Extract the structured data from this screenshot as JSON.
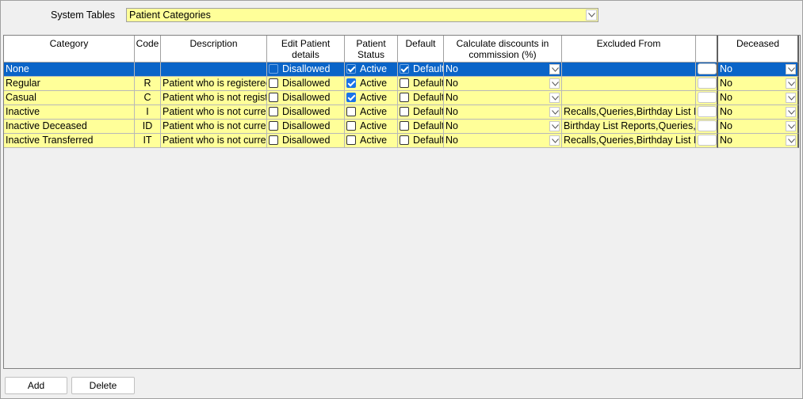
{
  "top": {
    "label": "System Tables",
    "selected": "Patient Categories"
  },
  "columns": [
    {
      "label": "Category"
    },
    {
      "label": "Code"
    },
    {
      "label": "Description"
    },
    {
      "label": "Edit Patient details"
    },
    {
      "label": "Patient Status"
    },
    {
      "label": "Default"
    },
    {
      "label": "Calculate discounts in commission (%)"
    },
    {
      "label": "Excluded From"
    },
    {
      "label": ""
    },
    {
      "label": "Deceased"
    }
  ],
  "rows": [
    {
      "category": "None",
      "code": "",
      "description": "",
      "edit_checked": false,
      "edit_label": "Disallowed",
      "status_checked": true,
      "status_label": "Active",
      "default_checked": true,
      "default_label": "Default",
      "discount": "No",
      "excluded": "",
      "deceased": "No"
    },
    {
      "category": "Regular",
      "code": "R",
      "description": "Patient who is registered",
      "edit_checked": false,
      "edit_label": "Disallowed",
      "status_checked": true,
      "status_label": "Active",
      "default_checked": false,
      "default_label": "Default",
      "discount": "No",
      "excluded": "",
      "deceased": "No"
    },
    {
      "category": "Casual",
      "code": "C",
      "description": "Patient who is not registered",
      "edit_checked": false,
      "edit_label": "Disallowed",
      "status_checked": true,
      "status_label": "Active",
      "default_checked": false,
      "default_label": "Default",
      "discount": "No",
      "excluded": "",
      "deceased": "No"
    },
    {
      "category": "Inactive",
      "code": "I",
      "description": "Patient who is not currently",
      "edit_checked": false,
      "edit_label": "Disallowed",
      "status_checked": false,
      "status_label": "Active",
      "default_checked": false,
      "default_label": "Default",
      "discount": "No",
      "excluded": "Recalls,Queries,Birthday List Reports",
      "deceased": "No"
    },
    {
      "category": "Inactive Deceased",
      "code": "ID",
      "description": "Patient who is not currently",
      "edit_checked": false,
      "edit_label": "Disallowed",
      "status_checked": false,
      "status_label": "Active",
      "default_checked": false,
      "default_label": "Default",
      "discount": "No",
      "excluded": "Birthday List Reports,Queries,Recalls",
      "deceased": "No"
    },
    {
      "category": "Inactive Transferred",
      "code": "IT",
      "description": "Patient who is not currently",
      "edit_checked": false,
      "edit_label": "Disallowed",
      "status_checked": false,
      "status_label": "Active",
      "default_checked": false,
      "default_label": "Default",
      "discount": "No",
      "excluded": "Recalls,Queries,Birthday List Reports",
      "deceased": "No"
    }
  ],
  "buttons": {
    "add": "Add",
    "delete": "Delete"
  },
  "colors": {
    "cell_bg": "#ffff99",
    "selected_row": "#0a64c8",
    "checkbox": "#1a73e8"
  }
}
